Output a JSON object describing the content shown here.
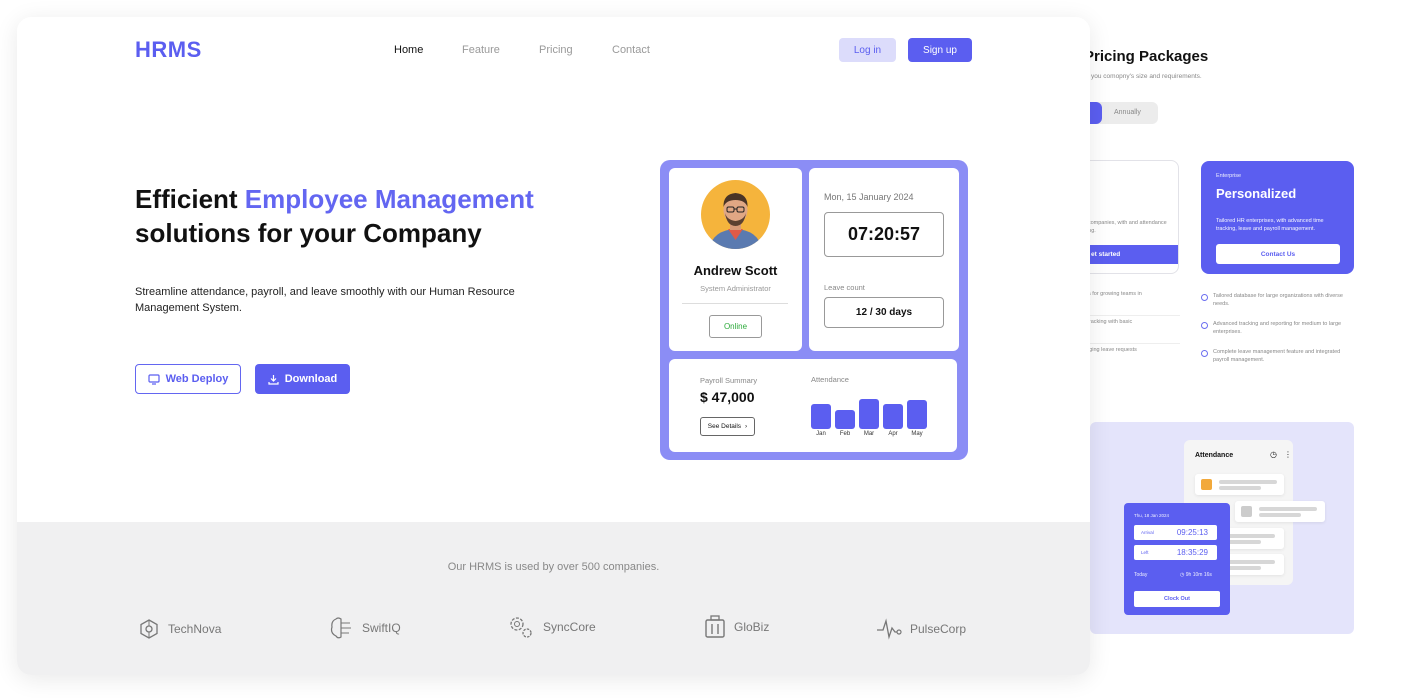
{
  "nav": {
    "logo": "HRMS",
    "links": [
      "Home",
      "Feature",
      "Pricing",
      "Contact"
    ],
    "login": "Log in",
    "signup": "Sign up"
  },
  "hero": {
    "title_prefix": "Efficient ",
    "title_accent": "Employee Management",
    "title_line2": "solutions for your Company",
    "description": "Streamline attendance, payroll, and leave smoothly with our Human Resource Management System.",
    "btn_web": "Web Deploy",
    "btn_download": "Download"
  },
  "dashboard": {
    "profile": {
      "name": "Andrew Scott",
      "role": "System Administrator",
      "status": "Online"
    },
    "date": "Mon, 15 January 2024",
    "time": "07:20:57",
    "leave_label": "Leave count",
    "leave_value": "12 / 30 days",
    "payroll_label": "Payroll Summary",
    "payroll_value": "$ 47,000",
    "details_btn": "See Details",
    "attendance_label": "Attendance"
  },
  "chart_data": {
    "type": "bar",
    "title": "Attendance",
    "categories": [
      "Jan",
      "Feb",
      "Mar",
      "Apr",
      "May"
    ],
    "values": [
      0.82,
      0.64,
      1.0,
      0.82,
      0.98
    ]
  },
  "footer": {
    "text": "Our HRMS is used by over 500 companies.",
    "brands": [
      "TechNova",
      "SwiftIQ",
      "SyncCore",
      "GloBiz",
      "PulseCorp"
    ]
  },
  "pricing": {
    "title": "Pricing Packages",
    "subtitle": "you comopny's size and requirements.",
    "toggle_label": "Annually",
    "basic": {
      "desc": "wing companies, with and attendance tracking.",
      "btn": "et started",
      "features": [
        "data for growing teams in",
        "ce tracking with basic",
        "anaging leave requests"
      ]
    },
    "enterprise": {
      "tag": "Enterprise",
      "name": "Personalized",
      "desc": "Tailored HR enterprises, with advanced time tracking, leave and payroll management.",
      "btn": "Contact Us",
      "features": [
        "Tailored database for large organizations with diverse needs.",
        "Advanced tracking and reporting for medium to large enterprises.",
        "Complete leave management feature and integrated payroll management."
      ]
    }
  },
  "attendance_widget": {
    "title": "Attendance",
    "date": "Thu, 18 Jan 2024",
    "arrival_label": "Arrival",
    "arrival_time": "09:25:13",
    "left_label": "Left",
    "left_time": "18:35:29",
    "today_label": "Today",
    "duration": "9h 10m 16s",
    "clockout": "Clock Out"
  },
  "colors": {
    "accent": "#5b5ef0",
    "accent_light": "#8b8df5",
    "online": "#2eab3c"
  }
}
